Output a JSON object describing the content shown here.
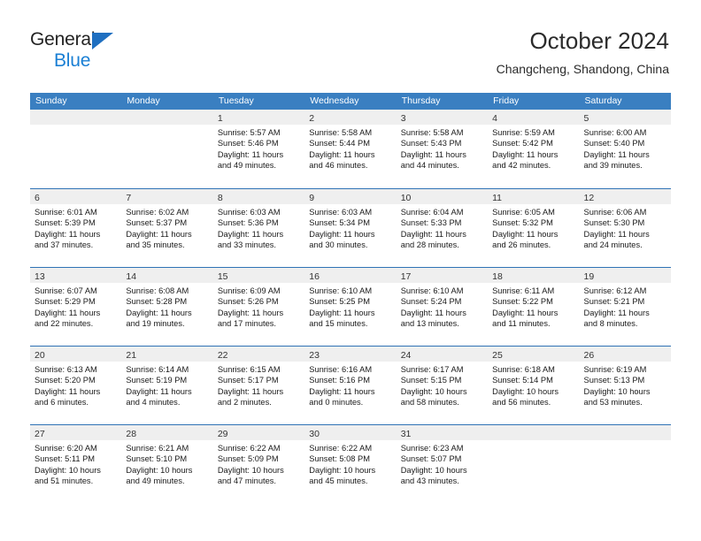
{
  "brand": {
    "name_part1": "General",
    "name_part2": "Blue",
    "accent_color": "#1a7fd4",
    "triangle_color": "#1f6fc0"
  },
  "header": {
    "title": "October 2024",
    "subtitle": "Changcheng, Shandong, China"
  },
  "theme": {
    "header_row_bg": "#3a7fc1",
    "week_divider": "#2f72b5",
    "date_band_bg": "#efefef"
  },
  "weekdays": [
    "Sunday",
    "Monday",
    "Tuesday",
    "Wednesday",
    "Thursday",
    "Friday",
    "Saturday"
  ],
  "weeks": [
    [
      {
        "day": "",
        "empty": true,
        "sunrise": "",
        "sunset": "",
        "daylight1": "",
        "daylight2": ""
      },
      {
        "day": "",
        "empty": true,
        "sunrise": "",
        "sunset": "",
        "daylight1": "",
        "daylight2": ""
      },
      {
        "day": "1",
        "empty": false,
        "sunrise": "Sunrise: 5:57 AM",
        "sunset": "Sunset: 5:46 PM",
        "daylight1": "Daylight: 11 hours",
        "daylight2": "and 49 minutes."
      },
      {
        "day": "2",
        "empty": false,
        "sunrise": "Sunrise: 5:58 AM",
        "sunset": "Sunset: 5:44 PM",
        "daylight1": "Daylight: 11 hours",
        "daylight2": "and 46 minutes."
      },
      {
        "day": "3",
        "empty": false,
        "sunrise": "Sunrise: 5:58 AM",
        "sunset": "Sunset: 5:43 PM",
        "daylight1": "Daylight: 11 hours",
        "daylight2": "and 44 minutes."
      },
      {
        "day": "4",
        "empty": false,
        "sunrise": "Sunrise: 5:59 AM",
        "sunset": "Sunset: 5:42 PM",
        "daylight1": "Daylight: 11 hours",
        "daylight2": "and 42 minutes."
      },
      {
        "day": "5",
        "empty": false,
        "sunrise": "Sunrise: 6:00 AM",
        "sunset": "Sunset: 5:40 PM",
        "daylight1": "Daylight: 11 hours",
        "daylight2": "and 39 minutes."
      }
    ],
    [
      {
        "day": "6",
        "empty": false,
        "sunrise": "Sunrise: 6:01 AM",
        "sunset": "Sunset: 5:39 PM",
        "daylight1": "Daylight: 11 hours",
        "daylight2": "and 37 minutes."
      },
      {
        "day": "7",
        "empty": false,
        "sunrise": "Sunrise: 6:02 AM",
        "sunset": "Sunset: 5:37 PM",
        "daylight1": "Daylight: 11 hours",
        "daylight2": "and 35 minutes."
      },
      {
        "day": "8",
        "empty": false,
        "sunrise": "Sunrise: 6:03 AM",
        "sunset": "Sunset: 5:36 PM",
        "daylight1": "Daylight: 11 hours",
        "daylight2": "and 33 minutes."
      },
      {
        "day": "9",
        "empty": false,
        "sunrise": "Sunrise: 6:03 AM",
        "sunset": "Sunset: 5:34 PM",
        "daylight1": "Daylight: 11 hours",
        "daylight2": "and 30 minutes."
      },
      {
        "day": "10",
        "empty": false,
        "sunrise": "Sunrise: 6:04 AM",
        "sunset": "Sunset: 5:33 PM",
        "daylight1": "Daylight: 11 hours",
        "daylight2": "and 28 minutes."
      },
      {
        "day": "11",
        "empty": false,
        "sunrise": "Sunrise: 6:05 AM",
        "sunset": "Sunset: 5:32 PM",
        "daylight1": "Daylight: 11 hours",
        "daylight2": "and 26 minutes."
      },
      {
        "day": "12",
        "empty": false,
        "sunrise": "Sunrise: 6:06 AM",
        "sunset": "Sunset: 5:30 PM",
        "daylight1": "Daylight: 11 hours",
        "daylight2": "and 24 minutes."
      }
    ],
    [
      {
        "day": "13",
        "empty": false,
        "sunrise": "Sunrise: 6:07 AM",
        "sunset": "Sunset: 5:29 PM",
        "daylight1": "Daylight: 11 hours",
        "daylight2": "and 22 minutes."
      },
      {
        "day": "14",
        "empty": false,
        "sunrise": "Sunrise: 6:08 AM",
        "sunset": "Sunset: 5:28 PM",
        "daylight1": "Daylight: 11 hours",
        "daylight2": "and 19 minutes."
      },
      {
        "day": "15",
        "empty": false,
        "sunrise": "Sunrise: 6:09 AM",
        "sunset": "Sunset: 5:26 PM",
        "daylight1": "Daylight: 11 hours",
        "daylight2": "and 17 minutes."
      },
      {
        "day": "16",
        "empty": false,
        "sunrise": "Sunrise: 6:10 AM",
        "sunset": "Sunset: 5:25 PM",
        "daylight1": "Daylight: 11 hours",
        "daylight2": "and 15 minutes."
      },
      {
        "day": "17",
        "empty": false,
        "sunrise": "Sunrise: 6:10 AM",
        "sunset": "Sunset: 5:24 PM",
        "daylight1": "Daylight: 11 hours",
        "daylight2": "and 13 minutes."
      },
      {
        "day": "18",
        "empty": false,
        "sunrise": "Sunrise: 6:11 AM",
        "sunset": "Sunset: 5:22 PM",
        "daylight1": "Daylight: 11 hours",
        "daylight2": "and 11 minutes."
      },
      {
        "day": "19",
        "empty": false,
        "sunrise": "Sunrise: 6:12 AM",
        "sunset": "Sunset: 5:21 PM",
        "daylight1": "Daylight: 11 hours",
        "daylight2": "and 8 minutes."
      }
    ],
    [
      {
        "day": "20",
        "empty": false,
        "sunrise": "Sunrise: 6:13 AM",
        "sunset": "Sunset: 5:20 PM",
        "daylight1": "Daylight: 11 hours",
        "daylight2": "and 6 minutes."
      },
      {
        "day": "21",
        "empty": false,
        "sunrise": "Sunrise: 6:14 AM",
        "sunset": "Sunset: 5:19 PM",
        "daylight1": "Daylight: 11 hours",
        "daylight2": "and 4 minutes."
      },
      {
        "day": "22",
        "empty": false,
        "sunrise": "Sunrise: 6:15 AM",
        "sunset": "Sunset: 5:17 PM",
        "daylight1": "Daylight: 11 hours",
        "daylight2": "and 2 minutes."
      },
      {
        "day": "23",
        "empty": false,
        "sunrise": "Sunrise: 6:16 AM",
        "sunset": "Sunset: 5:16 PM",
        "daylight1": "Daylight: 11 hours",
        "daylight2": "and 0 minutes."
      },
      {
        "day": "24",
        "empty": false,
        "sunrise": "Sunrise: 6:17 AM",
        "sunset": "Sunset: 5:15 PM",
        "daylight1": "Daylight: 10 hours",
        "daylight2": "and 58 minutes."
      },
      {
        "day": "25",
        "empty": false,
        "sunrise": "Sunrise: 6:18 AM",
        "sunset": "Sunset: 5:14 PM",
        "daylight1": "Daylight: 10 hours",
        "daylight2": "and 56 minutes."
      },
      {
        "day": "26",
        "empty": false,
        "sunrise": "Sunrise: 6:19 AM",
        "sunset": "Sunset: 5:13 PM",
        "daylight1": "Daylight: 10 hours",
        "daylight2": "and 53 minutes."
      }
    ],
    [
      {
        "day": "27",
        "empty": false,
        "sunrise": "Sunrise: 6:20 AM",
        "sunset": "Sunset: 5:11 PM",
        "daylight1": "Daylight: 10 hours",
        "daylight2": "and 51 minutes."
      },
      {
        "day": "28",
        "empty": false,
        "sunrise": "Sunrise: 6:21 AM",
        "sunset": "Sunset: 5:10 PM",
        "daylight1": "Daylight: 10 hours",
        "daylight2": "and 49 minutes."
      },
      {
        "day": "29",
        "empty": false,
        "sunrise": "Sunrise: 6:22 AM",
        "sunset": "Sunset: 5:09 PM",
        "daylight1": "Daylight: 10 hours",
        "daylight2": "and 47 minutes."
      },
      {
        "day": "30",
        "empty": false,
        "sunrise": "Sunrise: 6:22 AM",
        "sunset": "Sunset: 5:08 PM",
        "daylight1": "Daylight: 10 hours",
        "daylight2": "and 45 minutes."
      },
      {
        "day": "31",
        "empty": false,
        "sunrise": "Sunrise: 6:23 AM",
        "sunset": "Sunset: 5:07 PM",
        "daylight1": "Daylight: 10 hours",
        "daylight2": "and 43 minutes."
      },
      {
        "day": "",
        "empty": true,
        "sunrise": "",
        "sunset": "",
        "daylight1": "",
        "daylight2": ""
      },
      {
        "day": "",
        "empty": true,
        "sunrise": "",
        "sunset": "",
        "daylight1": "",
        "daylight2": ""
      }
    ]
  ]
}
